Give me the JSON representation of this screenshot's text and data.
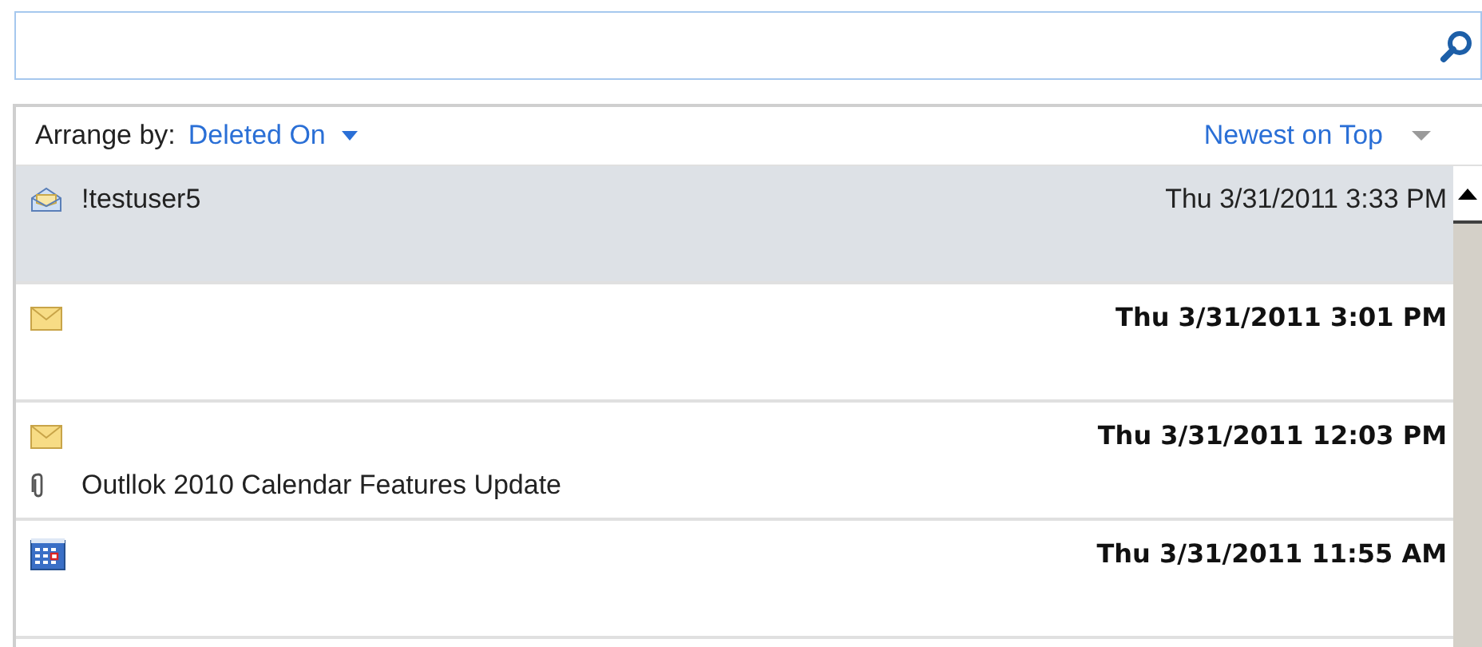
{
  "arrange": {
    "label": "Arrange by:",
    "value": "Deleted On",
    "order": "Newest on Top"
  },
  "messages": [
    {
      "kind": "read",
      "sender": "!testuser5",
      "date": "Thu 3/31/2011 3:33 PM",
      "unread": false,
      "selected": true,
      "attachment": false
    },
    {
      "kind": "unread",
      "date": "Thu 3/31/2011 3:01 PM",
      "unread": true,
      "selected": false,
      "attachment": false
    },
    {
      "kind": "unread",
      "date": "Thu 3/31/2011 12:03 PM",
      "subject": "Outllok 2010 Calendar Features Update",
      "unread": true,
      "selected": false,
      "attachment": true
    },
    {
      "kind": "calendar",
      "date": "Thu 3/31/2011 11:55 AM",
      "unread": true,
      "selected": false,
      "attachment": false
    }
  ]
}
